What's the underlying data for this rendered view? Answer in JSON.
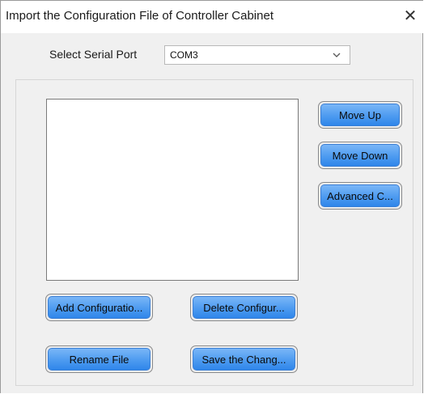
{
  "window": {
    "title": "Import the Configuration File of Controller Cabinet",
    "close_glyph": "✕"
  },
  "serial_port": {
    "label": "Select Serial Port",
    "selected": "COM3"
  },
  "file_list": {
    "items": []
  },
  "side_buttons": {
    "move_up": "Move Up",
    "move_down": "Move Down",
    "advanced": "Advanced C..."
  },
  "bottom_buttons": {
    "add": "Add Configuratio...",
    "delete": "Delete Configur...",
    "rename": "Rename File",
    "save": "Save the Chang..."
  },
  "colors": {
    "button_blue": "#4d9bf0",
    "dialog_bg": "#f0f0f0"
  },
  "icons": {
    "close": "close-icon",
    "dropdown": "chevron-down-icon"
  }
}
